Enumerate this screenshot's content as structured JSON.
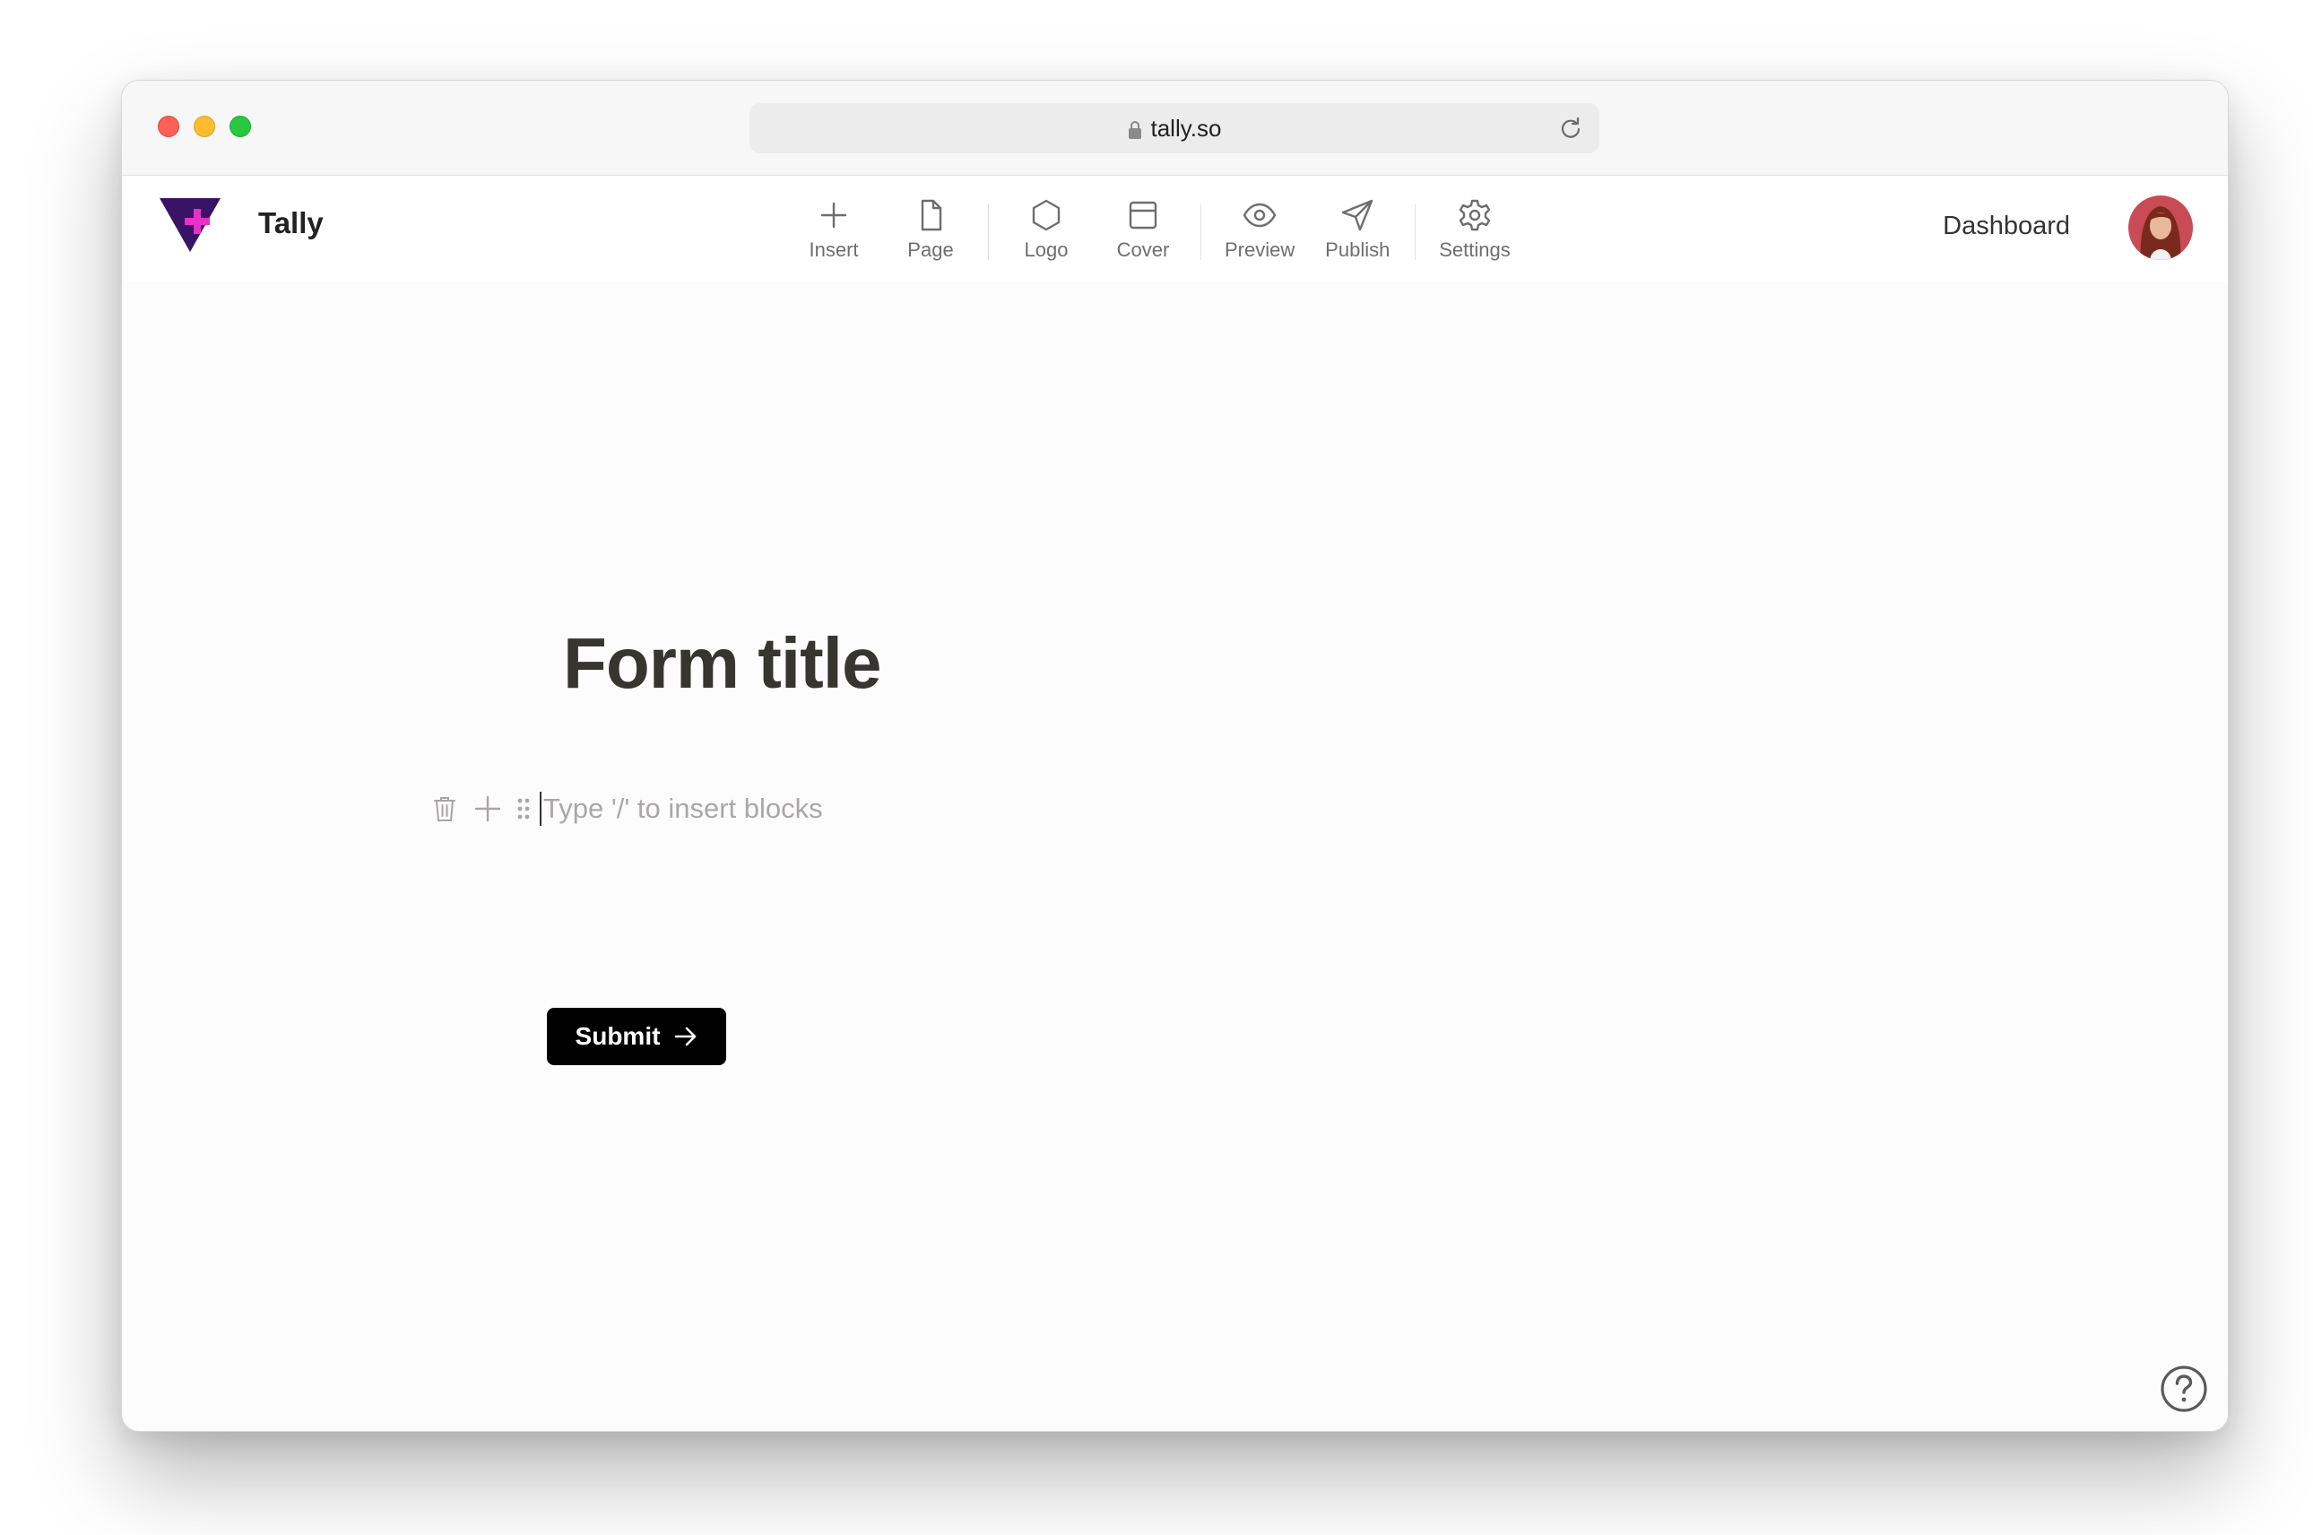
{
  "browser": {
    "url": "tally.so",
    "colors": {
      "close": "#fe5f57",
      "minimize": "#febc2e",
      "maximize": "#28c840"
    }
  },
  "app": {
    "brand": "Tally",
    "brand_colors": {
      "triangle": "#3b1366",
      "plus": "#e930c8"
    }
  },
  "toolbar": {
    "items": [
      {
        "label": "Insert",
        "icon": "plus-icon"
      },
      {
        "label": "Page",
        "icon": "page-icon"
      },
      {
        "label": "Logo",
        "icon": "hexagon-icon"
      },
      {
        "label": "Cover",
        "icon": "cover-icon"
      },
      {
        "label": "Preview",
        "icon": "eye-icon"
      },
      {
        "label": "Publish",
        "icon": "send-icon"
      },
      {
        "label": "Settings",
        "icon": "gear-icon"
      }
    ]
  },
  "header": {
    "dashboard_label": "Dashboard"
  },
  "form": {
    "title": "Form title",
    "block_placeholder": "Type '/' to insert blocks",
    "submit_label": "Submit"
  }
}
